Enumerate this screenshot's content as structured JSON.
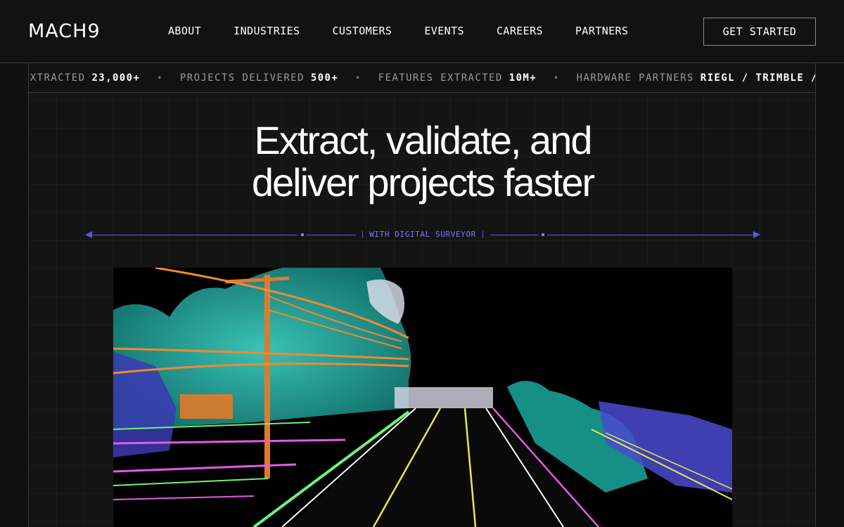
{
  "header": {
    "logo": "MACH9",
    "nav": [
      "ABOUT",
      "INDUSTRIES",
      "CUSTOMERS",
      "EVENTS",
      "CAREERS",
      "PARTNERS"
    ],
    "cta": "GET STARTED"
  },
  "ticker": [
    {
      "label": "EXTRACTED",
      "value": "23,000+"
    },
    {
      "label": "PROJECTS DELIVERED",
      "value": "500+"
    },
    {
      "label": "FEATURES EXTRACTED",
      "value": "10M+"
    },
    {
      "label": "HARDWARE PARTNERS",
      "value": "RIEGL / TRIMBLE /"
    }
  ],
  "hero": {
    "headline_line1": "Extract, validate, and",
    "headline_line2": "deliver projects faster",
    "subline": "WITH DIGITAL SURVEYOR"
  },
  "colors": {
    "background": "#111111",
    "accent": "#5b5bd6",
    "border": "#3a3a3a"
  }
}
